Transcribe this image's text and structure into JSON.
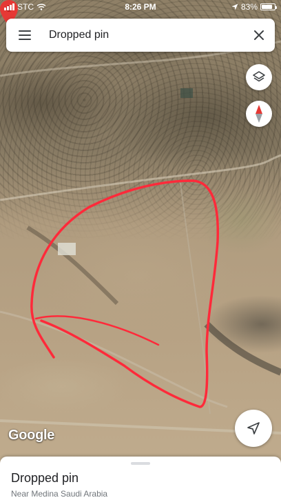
{
  "status_bar": {
    "carrier": "STC",
    "time": "8:26 PM",
    "battery_percent": "83%",
    "battery_level": 0.83
  },
  "search": {
    "value": "Dropped pin",
    "menu_icon": "hamburger-menu-icon",
    "close_icon": "close-icon"
  },
  "map_controls": {
    "layers_icon": "layers-icon",
    "compass_icon": "compass-icon",
    "location_icon": "navigation-arrow-icon"
  },
  "map": {
    "attribution": "Google",
    "pin_color": "#e53935",
    "annotation_color": "#ff2a3a"
  },
  "place_sheet": {
    "title": "Dropped pin",
    "subtitle": "Near Medina Saudi Arabia"
  }
}
